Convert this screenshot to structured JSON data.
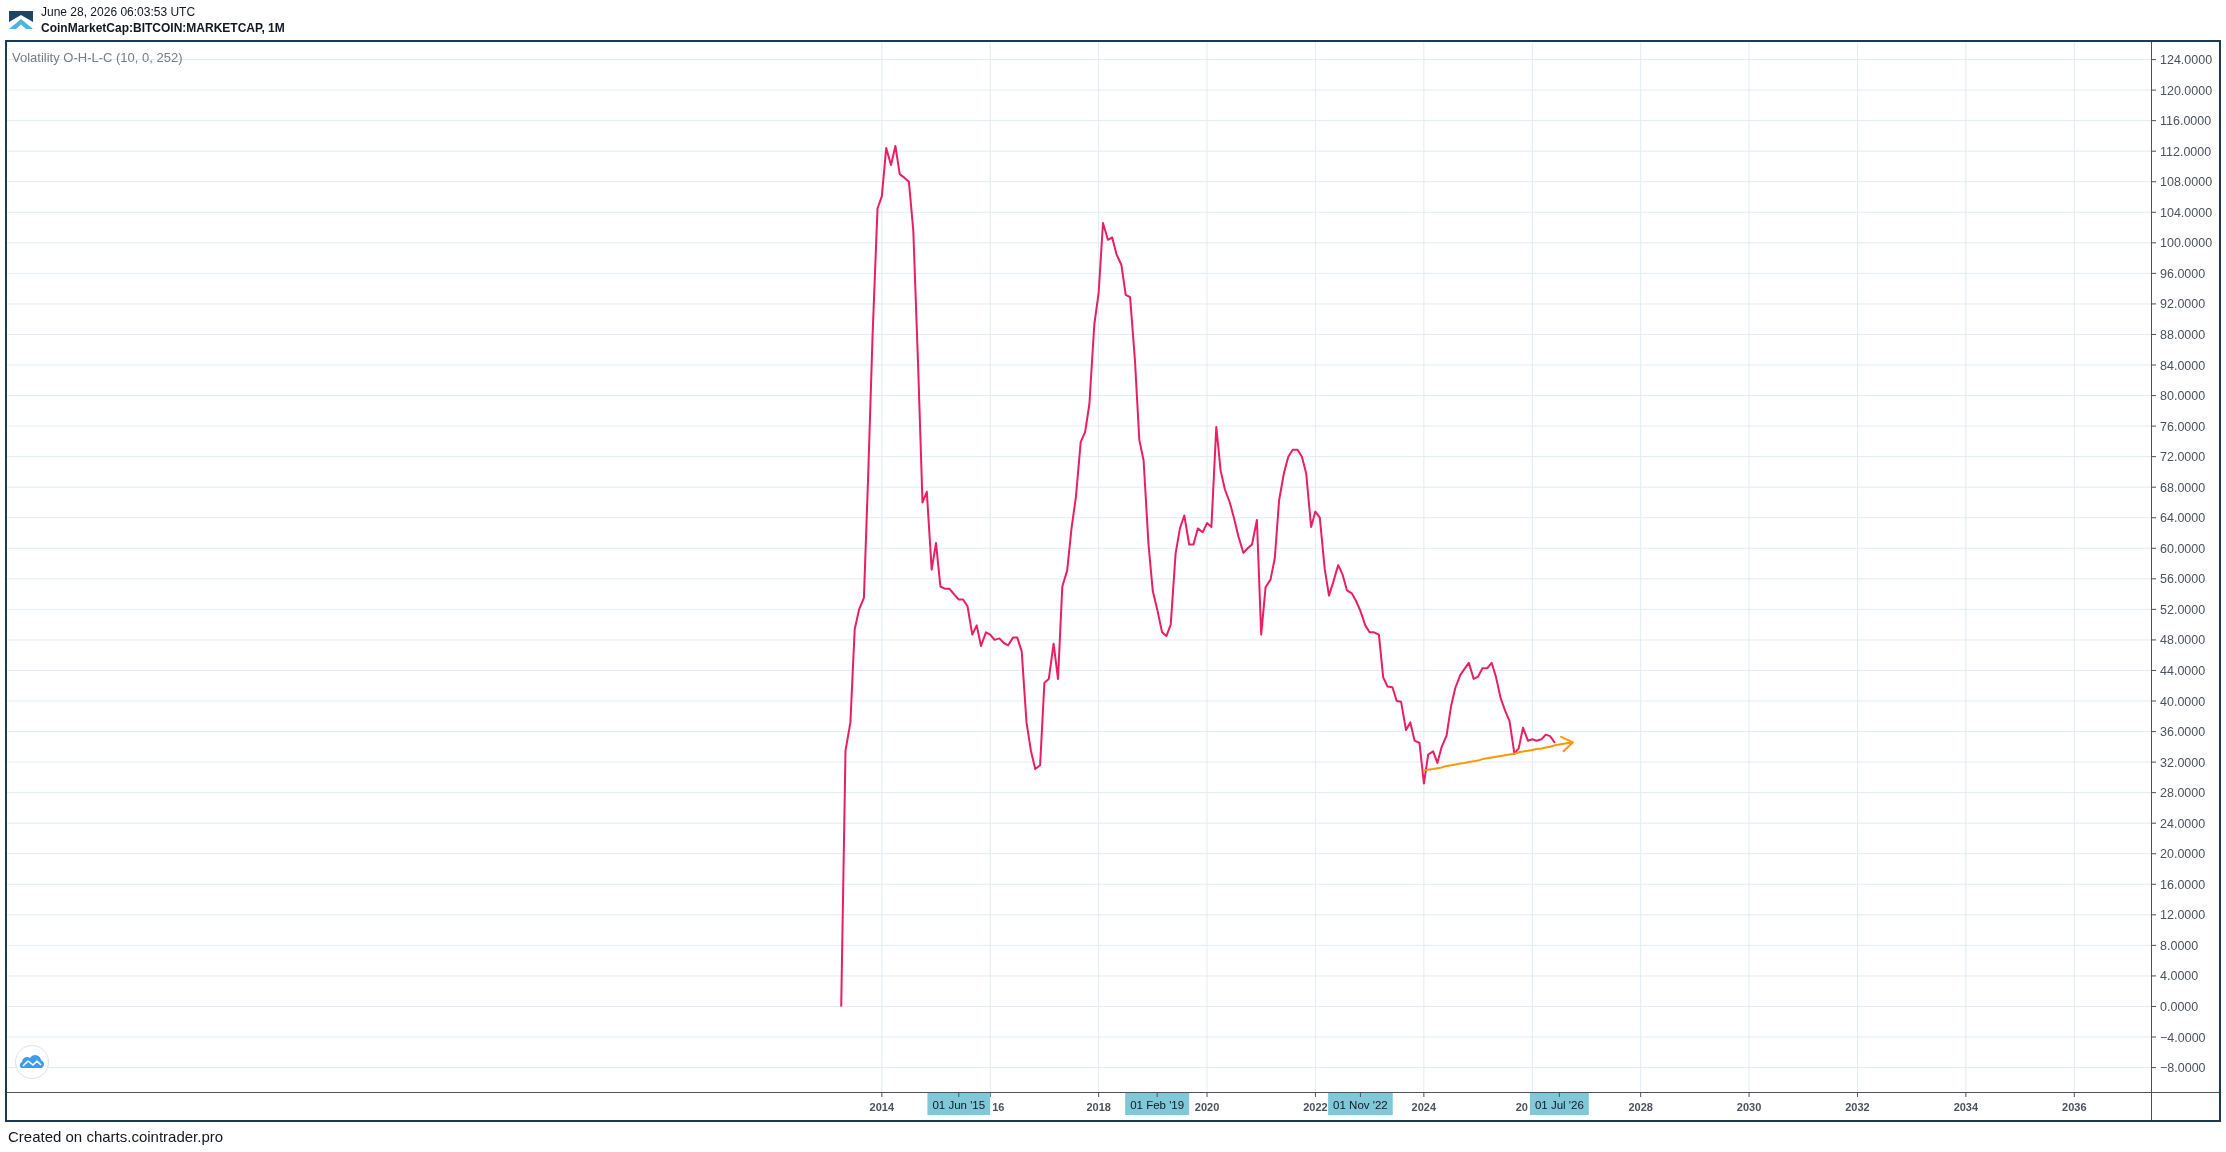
{
  "header": {
    "title": "June 28, 2026 06:03:53 UTC",
    "symbol": "CoinMarketCap:BITCOIN:MARKETCAP, 1M"
  },
  "chart": {
    "chart_data": {
      "type": "line",
      "x": [
        2013.25,
        2013.33,
        2013.42,
        2013.5,
        2013.58,
        2013.67,
        2013.75,
        2013.83,
        2013.92,
        2014,
        2014.08,
        2014.17,
        2014.25,
        2014.33,
        2014.42,
        2014.5,
        2014.58,
        2014.67,
        2014.75,
        2014.83,
        2014.92,
        2015,
        2015.08,
        2015.17,
        2015.25,
        2015.33,
        2015.42,
        2015.5,
        2015.58,
        2015.67,
        2015.75,
        2015.83,
        2015.92,
        2016,
        2016.08,
        2016.17,
        2016.25,
        2016.33,
        2016.42,
        2016.5,
        2016.58,
        2016.67,
        2016.75,
        2016.83,
        2016.92,
        2017,
        2017.08,
        2017.17,
        2017.25,
        2017.33,
        2017.42,
        2017.5,
        2017.58,
        2017.67,
        2017.75,
        2017.83,
        2017.92,
        2018,
        2018.08,
        2018.17,
        2018.25,
        2018.33,
        2018.42,
        2018.5,
        2018.58,
        2018.67,
        2018.75,
        2018.83,
        2018.92,
        2019,
        2019.08,
        2019.17,
        2019.25,
        2019.33,
        2019.42,
        2019.5,
        2019.58,
        2019.67,
        2019.75,
        2019.83,
        2019.92,
        2020,
        2020.08,
        2020.17,
        2020.25,
        2020.33,
        2020.42,
        2020.5,
        2020.58,
        2020.67,
        2020.75,
        2020.83,
        2020.92,
        2021,
        2021.08,
        2021.17,
        2021.25,
        2021.33,
        2021.42,
        2021.5,
        2021.58,
        2021.67,
        2021.75,
        2021.83,
        2021.92,
        2022,
        2022.08,
        2022.17,
        2022.25,
        2022.33,
        2022.42,
        2022.5,
        2022.58,
        2022.67,
        2022.75,
        2022.83,
        2022.92,
        2023,
        2023.08,
        2023.17,
        2023.25,
        2023.33,
        2023.42,
        2023.5,
        2023.58,
        2023.67,
        2023.75,
        2023.83,
        2023.92,
        2024,
        2024.08,
        2024.17,
        2024.25,
        2024.33,
        2024.42,
        2024.5,
        2024.58,
        2024.67,
        2024.75,
        2024.83,
        2024.92,
        2025,
        2025.08,
        2025.17,
        2025.25,
        2025.33,
        2025.42,
        2025.5,
        2025.58,
        2025.67,
        2025.75,
        2025.83,
        2025.92,
        2026,
        2026.08,
        2026.17,
        2026.25,
        2026.33,
        2026.42,
        2026.5,
        2026.58,
        2026.67,
        2026.75
      ],
      "series": [
        {
          "name": "Volatility O-H-L-C (10, 0, 252)",
          "color": "#e91e63",
          "values": [
            0,
            33.5,
            37.2,
            49.4,
            52,
            53.5,
            70,
            88,
            104.5,
            106.1,
            112.4,
            110.2,
            112.7,
            109,
            108.5,
            108,
            101.6,
            84,
            66,
            67.4,
            57.2,
            60.7,
            55,
            54.7,
            54.7,
            54,
            53.3,
            53.3,
            52.4,
            48.7,
            49.9,
            47.2,
            49,
            48.7,
            48,
            48.2,
            47.6,
            47.3,
            48.3,
            48.3,
            46.5,
            37.2,
            33.5,
            31.1,
            31.6,
            42.4,
            42.9,
            47.5,
            42.9,
            55,
            57.1,
            62.6,
            66.7,
            73.9,
            75.2,
            78.9,
            89.3,
            93.4,
            102.6,
            100.4,
            100.7,
            98.5,
            97.1,
            93.2,
            92.9,
            84.5,
            74.2,
            71.5,
            60.5,
            54.4,
            52,
            49,
            48.5,
            50,
            59.3,
            62.6,
            64.3,
            60.5,
            60.5,
            62.6,
            62.1,
            63.3,
            62.8,
            75.9,
            70.2,
            67.7,
            66,
            63.9,
            61.5,
            59.4,
            60,
            60.5,
            63.7,
            48.7,
            54.9,
            55.9,
            58.7,
            66.3,
            69.9,
            72,
            72.9,
            72.9,
            72,
            69.8,
            62.8,
            64.8,
            64,
            57.3,
            53.8,
            55.6,
            57.8,
            56.6,
            54.5,
            54.1,
            53.1,
            51.8,
            49.9,
            49,
            49,
            48.7,
            43.1,
            41.9,
            41.8,
            40,
            39.9,
            36.2,
            37.2,
            34.8,
            34.5,
            29.2,
            33,
            33.4,
            31.9,
            34,
            35.5,
            39.3,
            41.7,
            43.4,
            44.2,
            45,
            42.9,
            43.2,
            44.3,
            44.3,
            45,
            43.2,
            40.3,
            38.7,
            37.4,
            33.1,
            33.8,
            36.5,
            34.8,
            35,
            34.8,
            35,
            35.6,
            35.4,
            34.5,
            null,
            null,
            null,
            null
          ]
        },
        {
          "color": "#ff9800",
          "values": [
            null,
            null,
            null,
            null,
            null,
            null,
            null,
            null,
            null,
            null,
            null,
            null,
            null,
            null,
            null,
            null,
            null,
            null,
            null,
            null,
            null,
            null,
            null,
            null,
            null,
            null,
            null,
            null,
            null,
            null,
            null,
            null,
            null,
            null,
            null,
            null,
            null,
            null,
            null,
            null,
            null,
            null,
            null,
            null,
            null,
            null,
            null,
            null,
            null,
            null,
            null,
            null,
            null,
            null,
            null,
            null,
            null,
            null,
            null,
            null,
            null,
            null,
            null,
            null,
            null,
            null,
            null,
            null,
            null,
            null,
            null,
            null,
            null,
            null,
            null,
            null,
            null,
            null,
            null,
            null,
            null,
            null,
            null,
            null,
            null,
            null,
            null,
            null,
            null,
            null,
            null,
            null,
            null,
            null,
            null,
            null,
            null,
            null,
            null,
            null,
            null,
            null,
            null,
            null,
            null,
            null,
            null,
            null,
            null,
            null,
            null,
            null,
            null,
            null,
            null,
            null,
            null,
            null,
            null,
            null,
            null,
            null,
            null,
            null,
            null,
            null,
            null,
            null,
            null,
            30.9,
            31.0,
            31.1,
            31.2,
            31.3,
            31.5,
            31.6,
            31.7,
            31.8,
            31.9,
            32.0,
            32.1,
            32.2,
            32.4,
            32.5,
            32.6,
            32.7,
            32.8,
            32.9,
            33.0,
            33.1,
            33.3,
            33.4,
            33.5,
            33.6,
            33.7,
            33.8,
            33.9,
            34.0,
            34.2,
            34.3,
            34.4,
            34.5,
            34.6
          ]
        }
      ],
      "xlim": [
        1997.86,
        2038.67
      ],
      "ylim": [
        -11.2,
        126.3
      ],
      "grid": true,
      "xticks": [
        2014,
        2018,
        2020,
        2022,
        2024,
        2028,
        2030,
        2032,
        2034,
        2036
      ],
      "yticks": [
        {
          "value": 124,
          "label": "124.0000"
        },
        {
          "value": 120,
          "label": "120.0000"
        },
        {
          "value": 116,
          "label": "116.0000"
        },
        {
          "value": 112,
          "label": "112.0000"
        },
        {
          "value": 108,
          "label": "108.0000"
        },
        {
          "value": 104,
          "label": "104.0000"
        },
        {
          "value": 100,
          "label": "100.0000"
        },
        {
          "value": 96,
          "label": "96.0000"
        },
        {
          "value": 92,
          "label": "92.0000"
        },
        {
          "value": 88,
          "label": "88.0000"
        },
        {
          "value": 84,
          "label": "84.0000"
        },
        {
          "value": 80,
          "label": "80.0000"
        },
        {
          "value": 76,
          "label": "76.0000"
        },
        {
          "value": 72,
          "label": "72.0000"
        },
        {
          "value": 68,
          "label": "68.0000"
        },
        {
          "value": 64,
          "label": "64.0000"
        },
        {
          "value": 60,
          "label": "60.0000"
        },
        {
          "value": 56,
          "label": "56.0000"
        },
        {
          "value": 52,
          "label": "52.0000"
        },
        {
          "value": 48,
          "label": "48.0000"
        },
        {
          "value": 44,
          "label": "44.0000"
        },
        {
          "value": 40,
          "label": "40.0000"
        },
        {
          "value": 36,
          "label": "36.0000"
        },
        {
          "value": 32,
          "label": "32.0000"
        },
        {
          "value": 28,
          "label": "28.0000"
        },
        {
          "value": 24,
          "label": "24.0000"
        },
        {
          "value": 20,
          "label": "20.0000"
        },
        {
          "value": 16,
          "label": "16.0000"
        },
        {
          "value": 12,
          "label": "12.0000"
        },
        {
          "value": 8,
          "label": "8.0000"
        },
        {
          "value": 4,
          "label": "4.0000"
        },
        {
          "value": 0,
          "label": "0.0000"
        },
        {
          "value": -4,
          "label": "−4.0000"
        },
        {
          "value": -8,
          "label": "−8.0000"
        }
      ],
      "annotations": [
        "01 Jun '15",
        "01 Feb '19",
        "01 Nov '22",
        "01 Jul '26"
      ]
    },
    "covered_tick_labels": [
      {
        "text": "16",
        "kind": "tail"
      },
      {
        "text": "20",
        "kind": "head"
      }
    ]
  },
  "footer": {
    "credit": "Created on charts.cointrader.pro"
  }
}
